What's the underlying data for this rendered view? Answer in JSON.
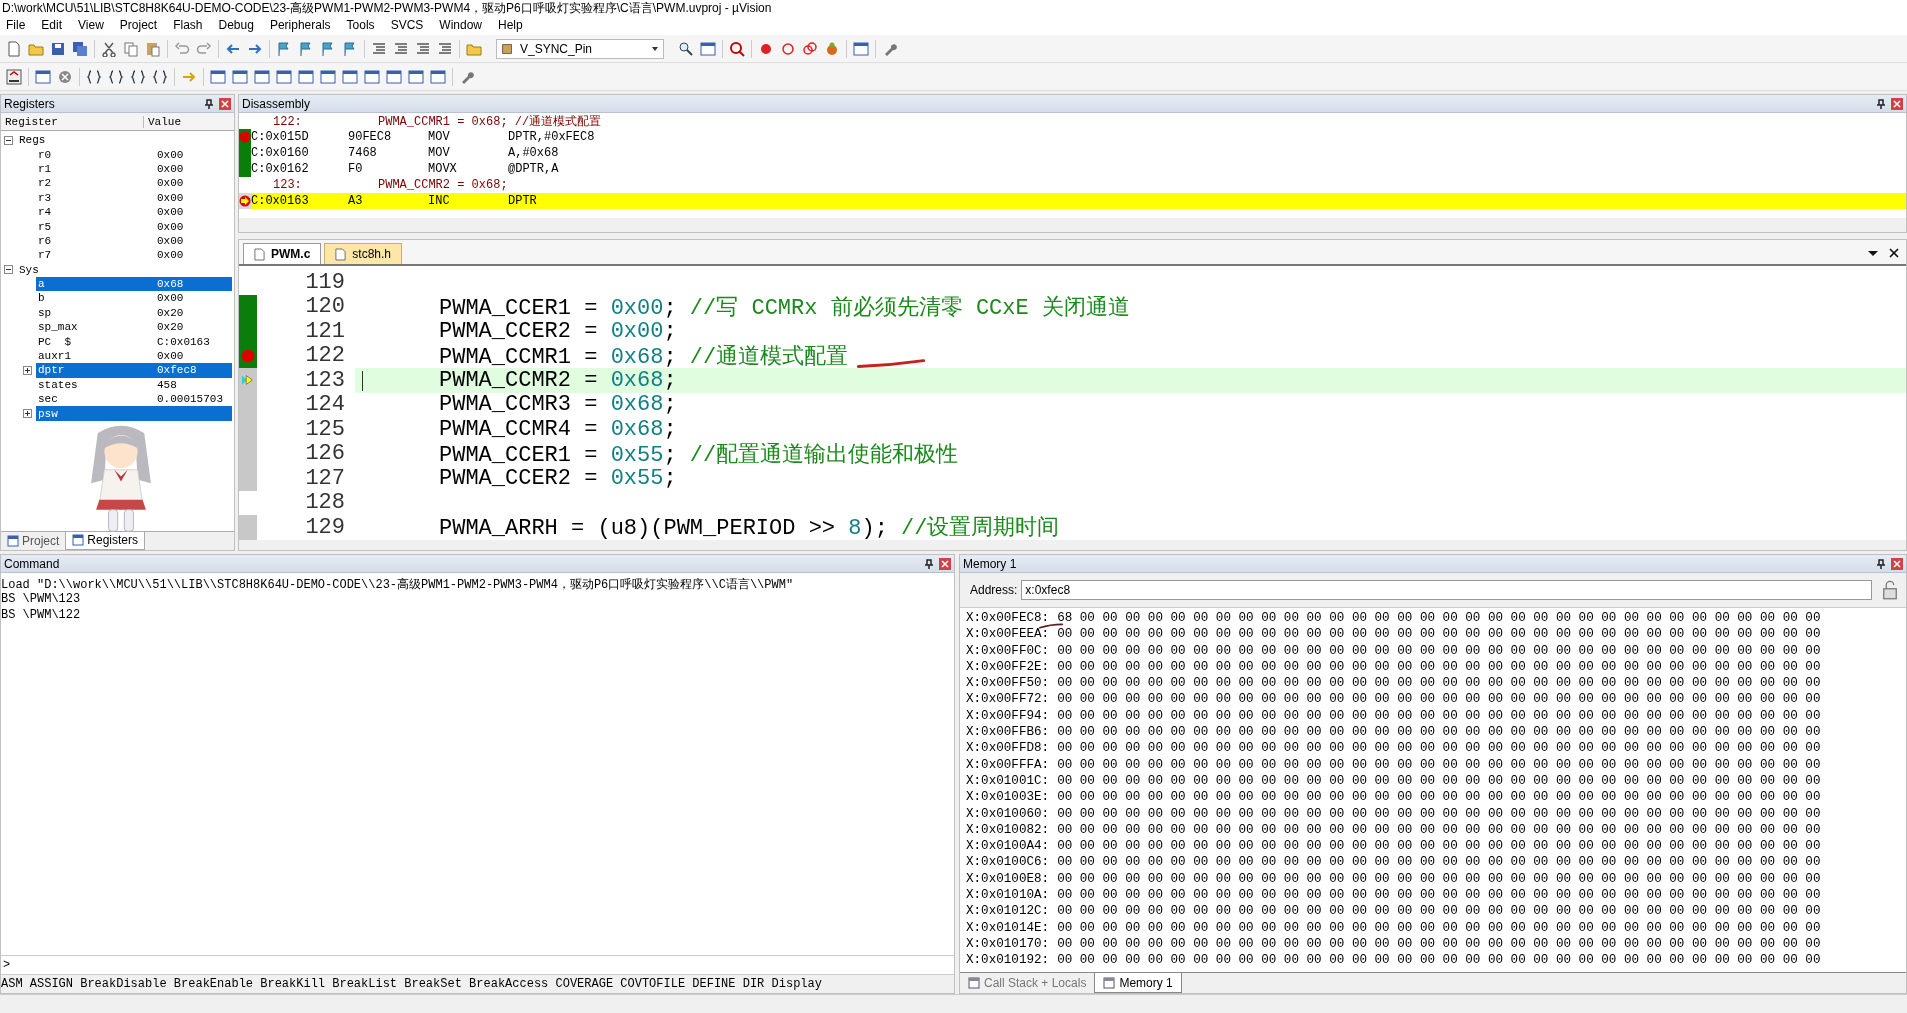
{
  "window": {
    "title": "D:\\work\\MCU\\51\\LIB\\STC8H8K64U-DEMO-CODE\\23-高级PWM1-PWM2-PWM3-PWM4，驱动P6口呼吸灯实验程序\\C语言\\PWM.uvproj - µVision"
  },
  "menu": [
    "File",
    "Edit",
    "View",
    "Project",
    "Flash",
    "Debug",
    "Peripherals",
    "Tools",
    "SVCS",
    "Window",
    "Help"
  ],
  "toolbar": {
    "target_dropdown": "V_SYNC_Pin"
  },
  "registers": {
    "title": "Registers",
    "columns": [
      "Register",
      "Value"
    ],
    "tree": [
      {
        "name": "Regs",
        "expanded": true,
        "children": [
          {
            "name": "r0",
            "value": "0x00",
            "selected": false
          },
          {
            "name": "r1",
            "value": "0x00",
            "selected": false
          },
          {
            "name": "r2",
            "value": "0x00",
            "selected": false
          },
          {
            "name": "r3",
            "value": "0x00",
            "selected": false
          },
          {
            "name": "r4",
            "value": "0x00",
            "selected": false
          },
          {
            "name": "r5",
            "value": "0x00",
            "selected": false
          },
          {
            "name": "r6",
            "value": "0x00",
            "selected": false
          },
          {
            "name": "r7",
            "value": "0x00",
            "selected": false
          }
        ]
      },
      {
        "name": "Sys",
        "expanded": true,
        "children": [
          {
            "name": "a",
            "value": "0x68",
            "selected": true
          },
          {
            "name": "b",
            "value": "0x00",
            "selected": false
          },
          {
            "name": "sp",
            "value": "0x20",
            "selected": false
          },
          {
            "name": "sp_max",
            "value": "0x20",
            "selected": false
          },
          {
            "name": "PC  $",
            "value": "C:0x0163",
            "selected": false
          },
          {
            "name": "auxr1",
            "value": "0x00",
            "selected": false
          },
          {
            "name": "dptr",
            "value": "0xfec8",
            "selected": true,
            "expanded": false
          },
          {
            "name": "states",
            "value": "458",
            "selected": false
          },
          {
            "name": "sec",
            "value": "0.00015703",
            "selected": false
          },
          {
            "name": "psw",
            "selected": true,
            "expanded": false
          }
        ]
      }
    ],
    "tabs": [
      {
        "label": "Project",
        "selected": false
      },
      {
        "label": "Registers",
        "selected": true
      }
    ]
  },
  "disassembly": {
    "title": "Disassembly",
    "rows": [
      {
        "kind": "source",
        "line": "122:",
        "text": "PWMA_CCMR1 = 0x68; //通道模式配置"
      },
      {
        "kind": "asm",
        "address": "C:0x015D",
        "opcode": "90FEC8",
        "mnemonic": "MOV",
        "operand": "DPTR,#0xFEC8",
        "executed": true,
        "breakpoint": true,
        "current": false
      },
      {
        "kind": "asm",
        "address": "C:0x0160",
        "opcode": "7468",
        "mnemonic": "MOV",
        "operand": "A,#0x68",
        "executed": true,
        "breakpoint": false,
        "current": false
      },
      {
        "kind": "asm",
        "address": "C:0x0162",
        "opcode": "F0",
        "mnemonic": "MOVX",
        "operand": "@DPTR,A",
        "executed": true,
        "breakpoint": false,
        "current": false
      },
      {
        "kind": "source",
        "line": "123:",
        "text": "PWMA_CCMR2 = 0x68;"
      },
      {
        "kind": "asm",
        "address": "C:0x0163",
        "opcode": "A3",
        "mnemonic": "INC",
        "operand": "DPTR",
        "executed": false,
        "breakpoint": false,
        "current": true
      }
    ]
  },
  "editor": {
    "tabs": [
      {
        "label": "PWM.c",
        "selected": true
      },
      {
        "label": "stc8h.h",
        "selected": false
      }
    ],
    "lines": [
      {
        "number": "119",
        "executable": false,
        "breakpoint": false,
        "current": false,
        "underline_mark": false
      },
      {
        "number": "120",
        "executable": true,
        "executed": true,
        "breakpoint": false,
        "current": false,
        "underline_mark": false,
        "tokens": [
          {
            "kind": "plain",
            "text": "PWMA_CCER1 = "
          },
          {
            "kind": "number",
            "text": "0x00"
          },
          {
            "kind": "plain",
            "text": "; "
          },
          {
            "kind": "comment",
            "text": "//写 CCMRx 前必须先清零 CCxE 关闭通道"
          }
        ]
      },
      {
        "number": "121",
        "executable": true,
        "executed": true,
        "breakpoint": false,
        "current": false,
        "underline_mark": false,
        "tokens": [
          {
            "kind": "plain",
            "text": "PWMA_CCER2 = "
          },
          {
            "kind": "number",
            "text": "0x00"
          },
          {
            "kind": "plain",
            "text": ";"
          }
        ]
      },
      {
        "number": "122",
        "executable": true,
        "executed": true,
        "breakpoint": true,
        "current": false,
        "underline_mark": true,
        "tokens": [
          {
            "kind": "plain",
            "text": "PWMA_CCMR1 = "
          },
          {
            "kind": "number",
            "text": "0x68"
          },
          {
            "kind": "plain",
            "text": "; "
          },
          {
            "kind": "comment",
            "text": "//通道模式配置"
          }
        ]
      },
      {
        "number": "123",
        "executable": true,
        "executed": false,
        "breakpoint": false,
        "current": true,
        "underline_mark": false,
        "tokens": [
          {
            "kind": "plain",
            "text": "PWMA_CCMR2 = "
          },
          {
            "kind": "number",
            "text": "0x68"
          },
          {
            "kind": "plain",
            "text": ";"
          }
        ]
      },
      {
        "number": "124",
        "executable": true,
        "executed": false,
        "breakpoint": false,
        "current": false,
        "underline_mark": false,
        "tokens": [
          {
            "kind": "plain",
            "text": "PWMA_CCMR3 = "
          },
          {
            "kind": "number",
            "text": "0x68"
          },
          {
            "kind": "plain",
            "text": ";"
          }
        ]
      },
      {
        "number": "125",
        "executable": true,
        "executed": false,
        "breakpoint": false,
        "current": false,
        "underline_mark": false,
        "tokens": [
          {
            "kind": "plain",
            "text": "PWMA_CCMR4 = "
          },
          {
            "kind": "number",
            "text": "0x68"
          },
          {
            "kind": "plain",
            "text": ";"
          }
        ]
      },
      {
        "number": "126",
        "executable": true,
        "executed": false,
        "breakpoint": false,
        "current": false,
        "underline_mark": false,
        "tokens": [
          {
            "kind": "plain",
            "text": "PWMA_CCER1 = "
          },
          {
            "kind": "number",
            "text": "0x55"
          },
          {
            "kind": "plain",
            "text": "; "
          },
          {
            "kind": "comment",
            "text": "//配置通道输出使能和极性"
          }
        ]
      },
      {
        "number": "127",
        "executable": true,
        "executed": false,
        "breakpoint": false,
        "current": false,
        "underline_mark": false,
        "tokens": [
          {
            "kind": "plain",
            "text": "PWMA_CCER2 = "
          },
          {
            "kind": "number",
            "text": "0x55"
          },
          {
            "kind": "plain",
            "text": ";"
          }
        ]
      },
      {
        "number": "128",
        "executable": false,
        "breakpoint": false,
        "current": false,
        "underline_mark": false
      },
      {
        "number": "129",
        "executable": true,
        "executed": false,
        "breakpoint": false,
        "current": false,
        "underline_mark": false,
        "tokens": [
          {
            "kind": "plain",
            "text": "PWMA_ARRH = (u8)(PWM_PERIOD >> "
          },
          {
            "kind": "number",
            "text": "8"
          },
          {
            "kind": "plain",
            "text": "); "
          },
          {
            "kind": "comment",
            "text": "//设置周期时间"
          }
        ]
      }
    ]
  },
  "command": {
    "title": "Command",
    "output": [
      "Load \"D:\\\\work\\\\MCU\\\\51\\\\LIB\\\\STC8H8K64U-DEMO-CODE\\\\23-高级PWM1-PWM2-PWM3-PWM4，驱动P6口呼吸灯实验程序\\\\C语言\\\\PWM\"",
      "BS \\PWM\\123",
      "BS \\PWM\\122"
    ],
    "prompt": ">",
    "help": "ASM ASSIGN BreakDisable BreakEnable BreakKill BreakList BreakSet BreakAccess COVERAGE COVTOFILE DEFINE DIR Display"
  },
  "memory": {
    "title": "Memory 1",
    "address_label": "Address:",
    "address": "x:0xfec8",
    "rows": [
      {
        "address": "X:0x00FEC8:",
        "bytes": "68 00 00 00 00 00 00 00 00 00 00 00 00 00 00 00 00 00 00 00 00 00 00 00 00 00 00 00 00 00 00 00 00 00",
        "underline_mark": true
      },
      {
        "address": "X:0x00FEEA:",
        "bytes": "00 00 00 00 00 00 00 00 00 00 00 00 00 00 00 00 00 00 00 00 00 00 00 00 00 00 00 00 00 00 00 00 00 00",
        "underline_mark": false
      },
      {
        "address": "X:0x00FF0C:",
        "bytes": "00 00 00 00 00 00 00 00 00 00 00 00 00 00 00 00 00 00 00 00 00 00 00 00 00 00 00 00 00 00 00 00 00 00",
        "underline_mark": false
      },
      {
        "address": "X:0x00FF2E:",
        "bytes": "00 00 00 00 00 00 00 00 00 00 00 00 00 00 00 00 00 00 00 00 00 00 00 00 00 00 00 00 00 00 00 00 00 00",
        "underline_mark": false
      },
      {
        "address": "X:0x00FF50:",
        "bytes": "00 00 00 00 00 00 00 00 00 00 00 00 00 00 00 00 00 00 00 00 00 00 00 00 00 00 00 00 00 00 00 00 00 00",
        "underline_mark": false
      },
      {
        "address": "X:0x00FF72:",
        "bytes": "00 00 00 00 00 00 00 00 00 00 00 00 00 00 00 00 00 00 00 00 00 00 00 00 00 00 00 00 00 00 00 00 00 00",
        "underline_mark": false
      },
      {
        "address": "X:0x00FF94:",
        "bytes": "00 00 00 00 00 00 00 00 00 00 00 00 00 00 00 00 00 00 00 00 00 00 00 00 00 00 00 00 00 00 00 00 00 00",
        "underline_mark": false
      },
      {
        "address": "X:0x00FFB6:",
        "bytes": "00 00 00 00 00 00 00 00 00 00 00 00 00 00 00 00 00 00 00 00 00 00 00 00 00 00 00 00 00 00 00 00 00 00",
        "underline_mark": false
      },
      {
        "address": "X:0x00FFD8:",
        "bytes": "00 00 00 00 00 00 00 00 00 00 00 00 00 00 00 00 00 00 00 00 00 00 00 00 00 00 00 00 00 00 00 00 00 00",
        "underline_mark": false
      },
      {
        "address": "X:0x00FFFA:",
        "bytes": "00 00 00 00 00 00 00 00 00 00 00 00 00 00 00 00 00 00 00 00 00 00 00 00 00 00 00 00 00 00 00 00 00 00",
        "underline_mark": false
      },
      {
        "address": "X:0x01001C:",
        "bytes": "00 00 00 00 00 00 00 00 00 00 00 00 00 00 00 00 00 00 00 00 00 00 00 00 00 00 00 00 00 00 00 00 00 00",
        "underline_mark": false
      },
      {
        "address": "X:0x01003E:",
        "bytes": "00 00 00 00 00 00 00 00 00 00 00 00 00 00 00 00 00 00 00 00 00 00 00 00 00 00 00 00 00 00 00 00 00 00",
        "underline_mark": false
      },
      {
        "address": "X:0x010060:",
        "bytes": "00 00 00 00 00 00 00 00 00 00 00 00 00 00 00 00 00 00 00 00 00 00 00 00 00 00 00 00 00 00 00 00 00 00",
        "underline_mark": false
      },
      {
        "address": "X:0x010082:",
        "bytes": "00 00 00 00 00 00 00 00 00 00 00 00 00 00 00 00 00 00 00 00 00 00 00 00 00 00 00 00 00 00 00 00 00 00",
        "underline_mark": false
      },
      {
        "address": "X:0x0100A4:",
        "bytes": "00 00 00 00 00 00 00 00 00 00 00 00 00 00 00 00 00 00 00 00 00 00 00 00 00 00 00 00 00 00 00 00 00 00",
        "underline_mark": false
      },
      {
        "address": "X:0x0100C6:",
        "bytes": "00 00 00 00 00 00 00 00 00 00 00 00 00 00 00 00 00 00 00 00 00 00 00 00 00 00 00 00 00 00 00 00 00 00",
        "underline_mark": false
      },
      {
        "address": "X:0x0100E8:",
        "bytes": "00 00 00 00 00 00 00 00 00 00 00 00 00 00 00 00 00 00 00 00 00 00 00 00 00 00 00 00 00 00 00 00 00 00",
        "underline_mark": false
      },
      {
        "address": "X:0x01010A:",
        "bytes": "00 00 00 00 00 00 00 00 00 00 00 00 00 00 00 00 00 00 00 00 00 00 00 00 00 00 00 00 00 00 00 00 00 00",
        "underline_mark": false
      },
      {
        "address": "X:0x01012C:",
        "bytes": "00 00 00 00 00 00 00 00 00 00 00 00 00 00 00 00 00 00 00 00 00 00 00 00 00 00 00 00 00 00 00 00 00 00",
        "underline_mark": false
      },
      {
        "address": "X:0x01014E:",
        "bytes": "00 00 00 00 00 00 00 00 00 00 00 00 00 00 00 00 00 00 00 00 00 00 00 00 00 00 00 00 00 00 00 00 00 00",
        "underline_mark": false
      },
      {
        "address": "X:0x010170:",
        "bytes": "00 00 00 00 00 00 00 00 00 00 00 00 00 00 00 00 00 00 00 00 00 00 00 00 00 00 00 00 00 00 00 00 00 00",
        "underline_mark": false
      },
      {
        "address": "X:0x010192:",
        "bytes": "00 00 00 00 00 00 00 00 00 00 00 00 00 00 00 00 00 00 00 00 00 00 00 00 00 00 00 00 00 00 00 00 00 00",
        "underline_mark": false
      }
    ],
    "tabs": [
      {
        "label": "Call Stack + Locals",
        "selected": false
      },
      {
        "label": "Memory 1",
        "selected": true
      }
    ]
  }
}
